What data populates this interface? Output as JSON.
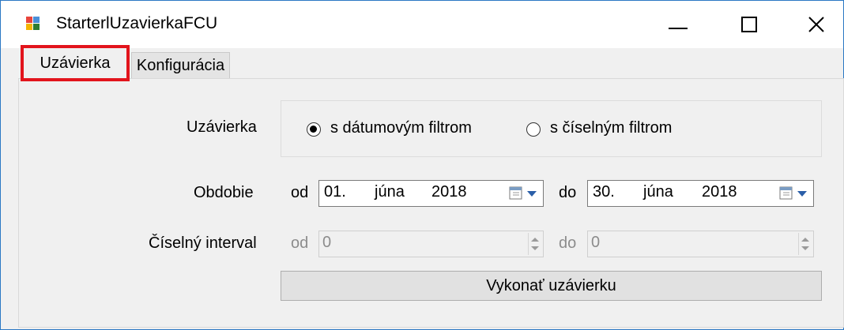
{
  "window": {
    "title": "StarterlUzavierkaFCU",
    "controls": {
      "minimize": "—",
      "maximize": "☐",
      "close": "✕"
    }
  },
  "tabs": [
    {
      "label": "Uzávierka",
      "active": true
    },
    {
      "label": "Konfigurácia",
      "active": false
    }
  ],
  "form": {
    "uzavierka_label": "Uzávierka",
    "radio_options": [
      {
        "label": "s dátumovým filtrom",
        "selected": true
      },
      {
        "label": "s číselným filtrom",
        "selected": false
      }
    ],
    "obdobie_label": "Obdobie",
    "from_label": "od",
    "to_label": "do",
    "date_from": {
      "day": "01.",
      "month": "júna",
      "year": "2018"
    },
    "date_to": {
      "day": "30.",
      "month": "júna",
      "year": "2018"
    },
    "ciselny_label": "Číselný interval",
    "num_from_label": "od",
    "num_to_label": "do",
    "num_from_value": "0",
    "num_to_value": "0",
    "execute_label": "Vykonať uzávierku"
  },
  "colors": {
    "highlight": "#e2141c",
    "window_border": "#2b78c4",
    "panel_bg": "#f0f0f0"
  }
}
